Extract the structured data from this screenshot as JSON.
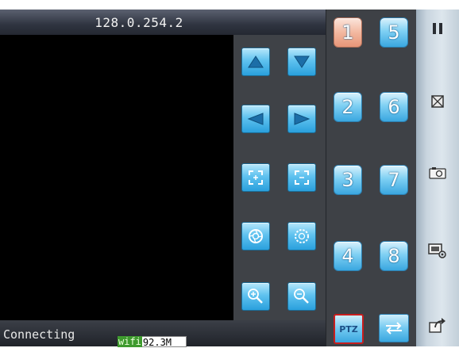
{
  "title_bar": {
    "ip_address": "128.0.254.2"
  },
  "status_bar": {
    "status_text": "Connecting",
    "wifi_label": "wifi",
    "data_rate": "92.3M"
  },
  "ptz_controls": [
    {
      "name": "tilt-up-button",
      "icon": "triangle-up-icon"
    },
    {
      "name": "tilt-down-button",
      "icon": "triangle-down-icon"
    },
    {
      "name": "pan-left-button",
      "icon": "triangle-left-icon"
    },
    {
      "name": "pan-right-button",
      "icon": "triangle-right-icon"
    },
    {
      "name": "zoom-in-frame-button",
      "icon": "frame-expand-icon"
    },
    {
      "name": "zoom-out-frame-button",
      "icon": "frame-shrink-icon"
    },
    {
      "name": "focus-near-button",
      "icon": "aperture-icon"
    },
    {
      "name": "focus-far-button",
      "icon": "aperture-dotted-icon"
    },
    {
      "name": "magnify-plus-button",
      "icon": "magnify-plus-icon"
    },
    {
      "name": "magnify-minus-button",
      "icon": "magnify-minus-icon"
    }
  ],
  "presets": {
    "left_column": [
      "1",
      "2",
      "3",
      "4"
    ],
    "right_column": [
      "5",
      "6",
      "7",
      "8"
    ],
    "active": "1"
  },
  "ptz_button": {
    "label": "PTZ"
  },
  "sidebar": [
    {
      "name": "pause-icon"
    },
    {
      "name": "stop-icon"
    },
    {
      "name": "snapshot-icon"
    },
    {
      "name": "record-settings-icon"
    },
    {
      "name": "exit-icon"
    }
  ],
  "colors": {
    "accent_button": "#3aa7e0",
    "active_preset": "#f3b8a0",
    "ptz_border": "#c81d1d"
  }
}
